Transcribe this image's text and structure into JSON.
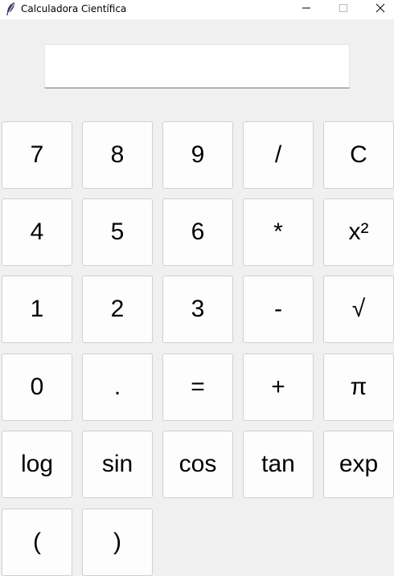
{
  "window": {
    "title": "Calculadora Científica",
    "controls": {
      "minimize": "minimize-icon",
      "maximize": "maximize-icon",
      "close": "close-icon"
    }
  },
  "display": {
    "value": ""
  },
  "buttons": {
    "r0": [
      "7",
      "8",
      "9",
      "/",
      "C"
    ],
    "r1": [
      "4",
      "5",
      "6",
      "*",
      "x²"
    ],
    "r2": [
      "1",
      "2",
      "3",
      "-",
      "√"
    ],
    "r3": [
      "0",
      ".",
      "=",
      "+",
      "π"
    ],
    "r4": [
      "log",
      "sin",
      "cos",
      "tan",
      "exp"
    ],
    "r5": [
      "(",
      ")"
    ]
  }
}
